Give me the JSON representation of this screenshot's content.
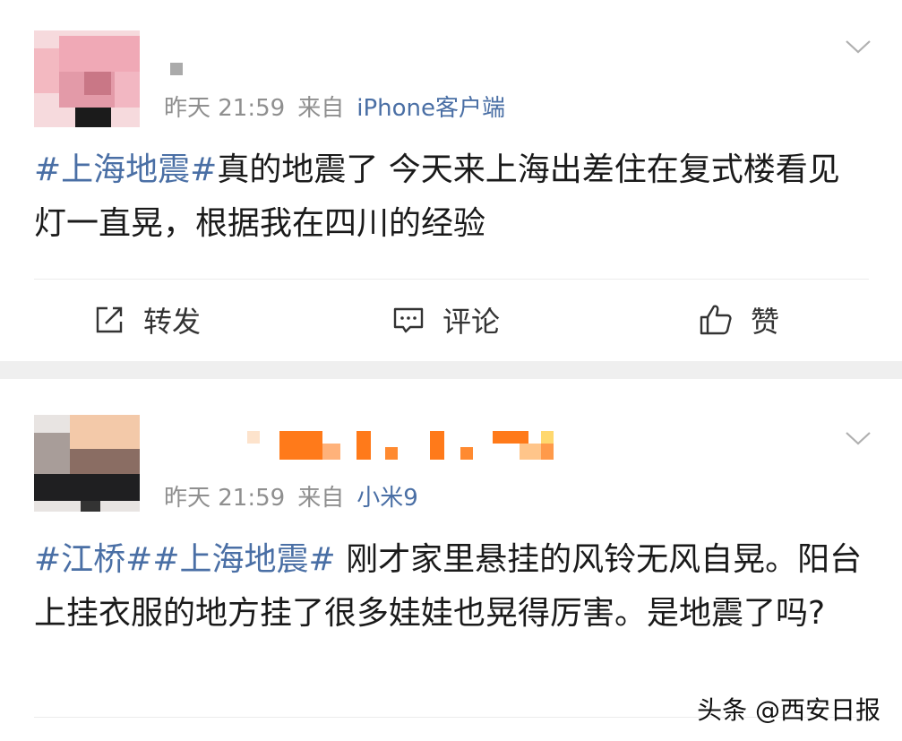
{
  "posts": [
    {
      "time": "昨天 21:59",
      "source_prefix": "来自",
      "source": "iPhone客户端",
      "text_parts": [
        {
          "tag": true,
          "text": "#上海地震#"
        },
        {
          "tag": false,
          "text": "真的地震了 今天来上海出差住在复式楼看见灯一直晃，根据我在四川的经验"
        }
      ],
      "actions": {
        "repost": "转发",
        "comment": "评论",
        "like": "赞"
      }
    },
    {
      "time": "昨天 21:59",
      "source_prefix": "来自",
      "source": "小米9",
      "text_parts": [
        {
          "tag": true,
          "text": "#江桥##上海地震#"
        },
        {
          "tag": false,
          "text": " 刚才家里悬挂的风铃无风自晃。阳台上挂衣服的地方挂了很多娃娃也晃得厉害。是地震了吗?"
        }
      ]
    }
  ],
  "watermark": "头条 @西安日报",
  "colors": {
    "link": "#4a6fa5",
    "meta": "#8f8f8f",
    "separator": "#efefef"
  },
  "icons": [
    "repost-icon",
    "comment-icon",
    "like-icon",
    "chevron-down-icon"
  ]
}
